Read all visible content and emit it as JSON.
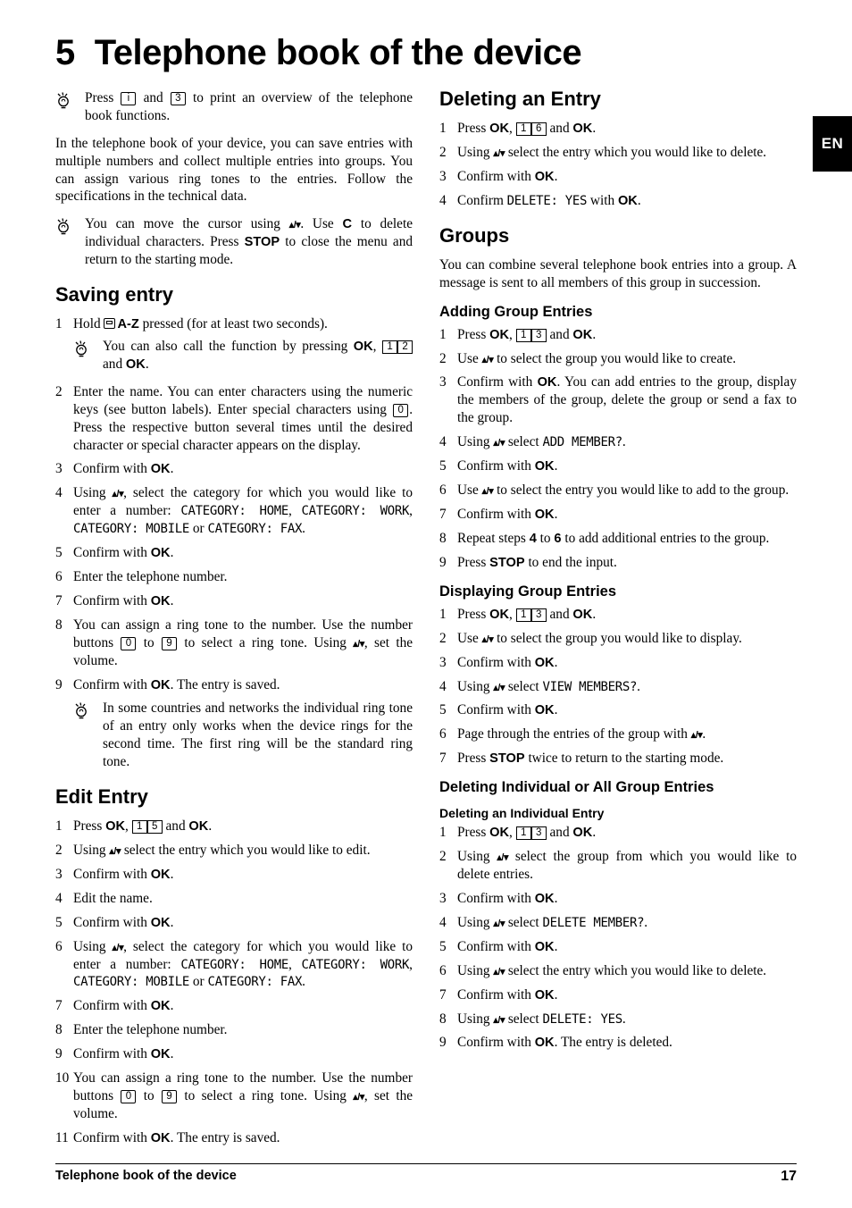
{
  "lang_tab": "EN",
  "chapter": {
    "number": "5",
    "title": "Telephone book of the device"
  },
  "footer": {
    "title": "Telephone book of the device",
    "page": "17"
  },
  "left": {
    "intro_hint": {
      "pre": "Press",
      "key1": "i",
      "mid": "and",
      "key2": "3",
      "post": "to print an overview of the telephone book functions."
    },
    "intro_para": "In the telephone book of your device, you can save entries with multiple numbers and collect multiple entries into groups. You can assign various ring tones to the entries. Follow the specifications in the technical data.",
    "cursor_hint": {
      "p1": "You can move the cursor using",
      "arrows": "▴/▾",
      "p2": ". Use",
      "key_c": "C",
      "p3": "to delete individual characters. Press",
      "key_stop": "STOP",
      "p4": "to close the menu and return to the starting mode."
    },
    "saving_entry": {
      "heading": "Saving entry",
      "steps": [
        {
          "num": "1",
          "text_pre": "Hold",
          "az": "A-Z",
          "text_post": "pressed (for at least two seconds)."
        },
        {
          "num": "2",
          "text": "Enter the name. You can enter characters using the numeric keys (see button labels).  Enter special characters using",
          "key": "0",
          "text2": ". Press the respective button several times until the desired character or special character appears on the display."
        },
        {
          "num": "3",
          "text": "Confirm with",
          "bold": "OK",
          "text2": "."
        },
        {
          "num": "4",
          "text": "Using",
          "arrows": "▴/▾",
          "text2": ", select the category for which you would like to enter a number:",
          "mono1": "CATEGORY: HOME",
          "mono2": "CATEGORY: WORK",
          "mono3": "CATEGORY: MOBILE",
          "or": "or",
          "mono4": "CATEGORY: FAX",
          "tail": "."
        },
        {
          "num": "5",
          "text": "Confirm with",
          "bold": "OK",
          "text2": "."
        },
        {
          "num": "6",
          "text": "Enter the telephone number."
        },
        {
          "num": "7",
          "text": "Confirm with",
          "bold": "OK",
          "text2": "."
        },
        {
          "num": "8",
          "text": "You can assign a ring tone to the number. Use the number buttons",
          "key1": "0",
          "mid": "to",
          "key2": "9",
          "text2": "to select a ring tone. Using",
          "arrows": "▴/▾",
          "text3": ", set the volume."
        },
        {
          "num": "9",
          "text": "Confirm with",
          "bold": "OK",
          "text2": ". The entry is saved."
        }
      ],
      "sub_hint": {
        "p1": "You can also call the function by pressing",
        "bold": "OK",
        "keypair": [
          "1",
          "2"
        ],
        "p2": "and",
        "bold2": "OK",
        "p3": "."
      },
      "ringtone_hint": "In some countries and networks the individual ring tone of an entry only works when the device rings for the second time. The first ring will be the standard ring tone."
    },
    "edit_entry": {
      "heading": "Edit Entry",
      "steps": [
        {
          "num": "1",
          "text": "Press",
          "bold": "OK",
          "comma": ",",
          "keypair": [
            "1",
            "5"
          ],
          "text2": "and",
          "bold2": "OK",
          "tail": "."
        },
        {
          "num": "2",
          "text": "Using",
          "arrows": "▴/▾",
          "text2": "select the entry which you would like to edit."
        },
        {
          "num": "3",
          "text": "Confirm with",
          "bold": "OK",
          "text2": "."
        },
        {
          "num": "4",
          "text": "Edit the name."
        },
        {
          "num": "5",
          "text": "Confirm with",
          "bold": "OK",
          "text2": "."
        },
        {
          "num": "6",
          "text": "Using",
          "arrows": "▴/▾",
          "text2": ", select the category for which you would like to enter a number:",
          "mono1": "CATEGORY: HOME",
          "mono2": "CATEGORY: WORK",
          "mono3": "CATEGORY: MOBILE",
          "or": "or",
          "mono4": "CATEGORY: FAX",
          "tail": "."
        },
        {
          "num": "7",
          "text": "Confirm with",
          "bold": "OK",
          "text2": "."
        },
        {
          "num": "8",
          "text": "Enter the telephone number."
        },
        {
          "num": "9",
          "text": "Confirm with",
          "bold": "OK",
          "text2": "."
        },
        {
          "num": "10",
          "text": "You can assign a ring tone to the number. Use the number buttons",
          "key1": "0",
          "mid": "to",
          "key2": "9",
          "text2": "to select a ring tone. Using",
          "arrows": "▴/▾",
          "text3": ", set the volume."
        },
        {
          "num": "11",
          "text": "Confirm with",
          "bold": "OK",
          "text2": ". The entry is saved."
        }
      ]
    }
  },
  "right": {
    "deleting_entry": {
      "heading": "Deleting an Entry",
      "steps": [
        {
          "num": "1",
          "text": "Press",
          "bold": "OK",
          "comma": ",",
          "keypair": [
            "1",
            "6"
          ],
          "text2": "and",
          "bold2": "OK",
          "tail": "."
        },
        {
          "num": "2",
          "text": "Using",
          "arrows": "▴/▾",
          "text2": "select the entry which you would like to delete."
        },
        {
          "num": "3",
          "text": "Confirm with",
          "bold": "OK",
          "tail": "."
        },
        {
          "num": "4",
          "text": "Confirm",
          "mono": "DELETE: YES",
          "text2": "with",
          "bold": "OK",
          "tail": "."
        }
      ]
    },
    "groups": {
      "heading": "Groups",
      "para": "You can combine several telephone book entries into a group. A message is sent to all members of this group in succession."
    },
    "adding_group": {
      "heading": "Adding Group Entries",
      "steps": [
        {
          "num": "1",
          "text": "Press",
          "bold": "OK",
          "comma": ",",
          "keypair": [
            "1",
            "3"
          ],
          "text2": "and",
          "bold2": "OK",
          "tail": "."
        },
        {
          "num": "2",
          "text": "Use",
          "arrows": "▴/▾",
          "text2": "to select the group you would like to create."
        },
        {
          "num": "3",
          "text": "Confirm with",
          "bold": "OK",
          "text2": ". You can add entries to the group, display the members of the group, delete the group or send a fax to the group."
        },
        {
          "num": "4",
          "text": "Using",
          "arrows": "▴/▾",
          "text2": "select",
          "mono": "ADD MEMBER?",
          "tail": "."
        },
        {
          "num": "5",
          "text": "Confirm with",
          "bold": "OK",
          "tail": "."
        },
        {
          "num": "6",
          "text": "Use",
          "arrows": "▴/▾",
          "text2": "to select the entry you would like to add to the group."
        },
        {
          "num": "7",
          "text": "Confirm with",
          "bold": "OK",
          "tail": "."
        },
        {
          "num": "8",
          "text": "Repeat steps",
          "b1": "4",
          "mid": "to",
          "b2": "6",
          "text2": "to add additional entries to the group."
        },
        {
          "num": "9",
          "text": "Press",
          "bold": "STOP",
          "text2": "to end the input."
        }
      ]
    },
    "displaying_group": {
      "heading": "Displaying Group Entries",
      "steps": [
        {
          "num": "1",
          "text": "Press",
          "bold": "OK",
          "comma": ",",
          "keypair": [
            "1",
            "3"
          ],
          "text2": "and",
          "bold2": "OK",
          "tail": "."
        },
        {
          "num": "2",
          "text": "Use",
          "arrows": "▴/▾",
          "text2": "to select the group you would like to display."
        },
        {
          "num": "3",
          "text": "Confirm with",
          "bold": "OK",
          "tail": "."
        },
        {
          "num": "4",
          "text": "Using",
          "arrows": "▴/▾",
          "text2": "select",
          "mono": "VIEW MEMBERS?",
          "tail": "."
        },
        {
          "num": "5",
          "text": "Confirm with",
          "bold": "OK",
          "tail": "."
        },
        {
          "num": "6",
          "text": "Page through the entries of the group with",
          "arrows": "▴/▾",
          "tail": "."
        },
        {
          "num": "7",
          "text": "Press",
          "bold": "STOP",
          "text2": "twice to return to the starting mode."
        }
      ]
    },
    "deleting_group": {
      "heading": "Deleting Individual or All Group Entries",
      "sub_heading": "Deleting an Individual Entry",
      "steps": [
        {
          "num": "1",
          "text": "Press",
          "bold": "OK",
          "comma": ",",
          "keypair": [
            "1",
            "3"
          ],
          "text2": "and",
          "bold2": "OK",
          "tail": "."
        },
        {
          "num": "2",
          "text": "Using",
          "arrows": "▴/▾",
          "text2": "select the group from which you would like to delete entries."
        },
        {
          "num": "3",
          "text": "Confirm with",
          "bold": "OK",
          "tail": "."
        },
        {
          "num": "4",
          "text": "Using",
          "arrows": "▴/▾",
          "text2": "select",
          "mono": "DELETE MEMBER?",
          "tail": "."
        },
        {
          "num": "5",
          "text": "Confirm with",
          "bold": "OK",
          "tail": "."
        },
        {
          "num": "6",
          "text": "Using",
          "arrows": "▴/▾",
          "text2": "select the entry which you would like to delete."
        },
        {
          "num": "7",
          "text": "Confirm with",
          "bold": "OK",
          "tail": "."
        },
        {
          "num": "8",
          "text": "Using",
          "arrows": "▴/▾",
          "text2": "select",
          "mono": "DELETE: YES",
          "tail": "."
        },
        {
          "num": "9",
          "text": "Confirm with",
          "bold": "OK",
          "text2": ". The entry is deleted."
        }
      ]
    }
  }
}
